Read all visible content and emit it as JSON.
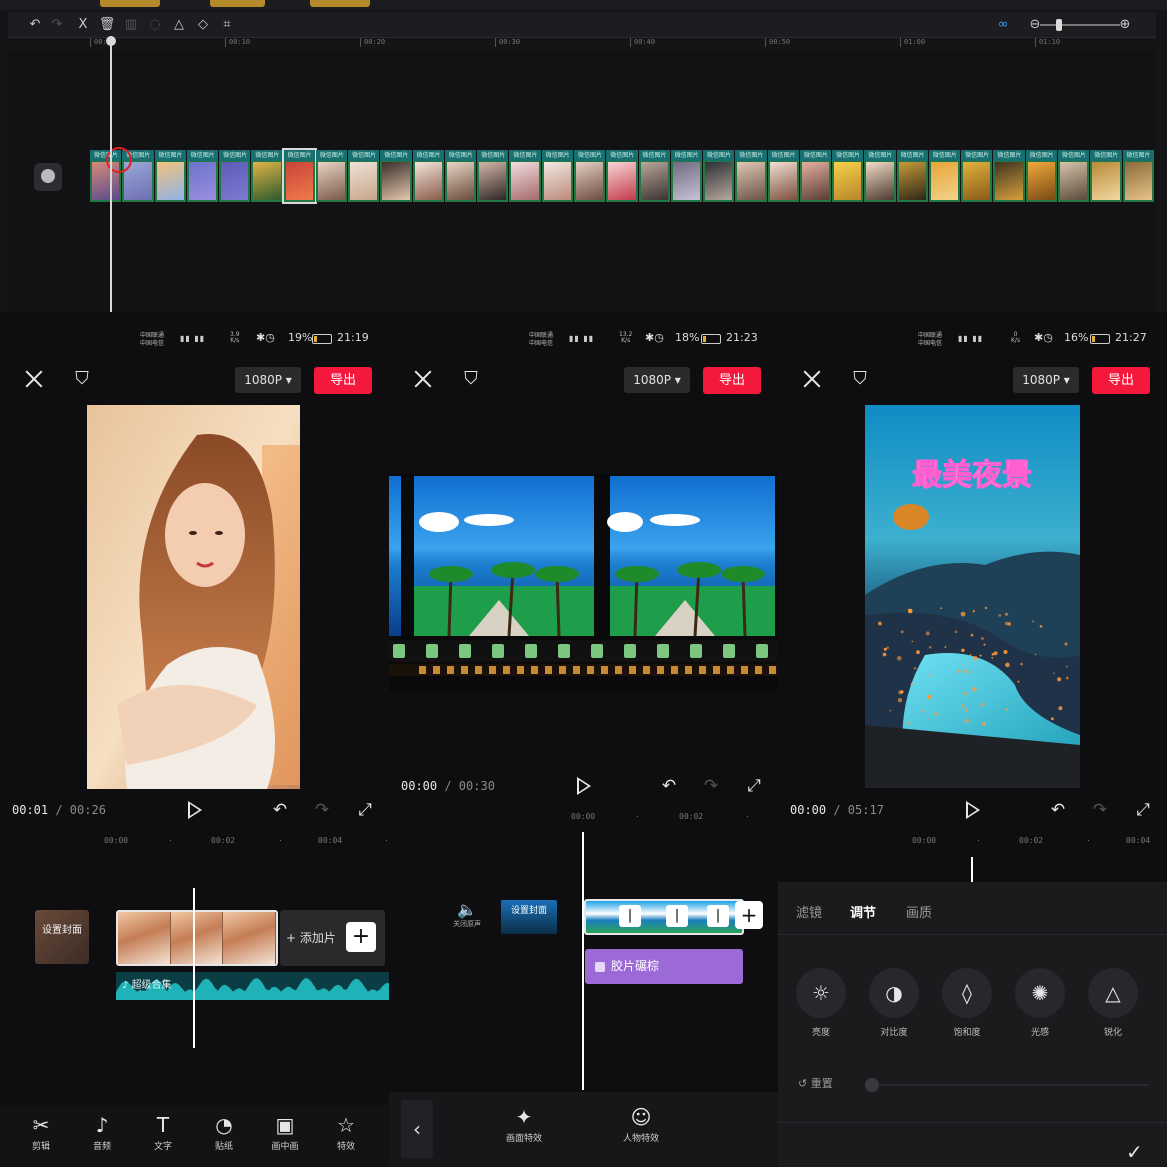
{
  "desktop": {
    "toolbar_icons": [
      "undo-icon",
      "redo-icon",
      "split-icon",
      "delete-icon",
      "freeze-icon",
      "reverse-icon",
      "mirror-icon",
      "rotate-icon",
      "crop-icon"
    ],
    "ruler": [
      "00:00",
      "00:10",
      "00:20",
      "00:30",
      "00:40",
      "00:50",
      "01:00",
      "01:10"
    ],
    "clip_label": "微信图片",
    "clip_count": 33
  },
  "panels": [
    {
      "status": {
        "carrier1": "中国联通",
        "carrier2": "中国电信",
        "speed_top": "3.9",
        "speed_bottom": "K/s",
        "battery": "19%",
        "battery_level": 0.19,
        "time": "21:19"
      },
      "resolution": "1080P ▾",
      "export": "导出",
      "timecode_current": "00:01",
      "timecode_total": " / 00:26",
      "ruler": [
        "00:00",
        "00:02",
        "00:04"
      ],
      "cover_label": "设置封面",
      "add_clip": "+ 添加片",
      "audio_label": "♪ 超级合集",
      "tools": [
        {
          "icon": "scissors-icon",
          "glyph": "✂",
          "label": "剪辑"
        },
        {
          "icon": "music-icon",
          "glyph": "♪",
          "label": "音频"
        },
        {
          "icon": "text-icon",
          "glyph": "T",
          "label": "文字"
        },
        {
          "icon": "sticker-icon",
          "glyph": "◔",
          "label": "贴纸"
        },
        {
          "icon": "pip-icon",
          "glyph": "▣",
          "label": "画中画"
        },
        {
          "icon": "effects-icon",
          "glyph": "☆",
          "label": "特效"
        }
      ]
    },
    {
      "status": {
        "carrier1": "中国联通",
        "carrier2": "中国电信",
        "speed_top": "13.2",
        "speed_bottom": "K/s",
        "battery": "18%",
        "battery_level": 0.18,
        "time": "21:23"
      },
      "resolution": "1080P ▾",
      "export": "导出",
      "timecode_current": "00:00",
      "timecode_total": " / 00:30",
      "ruler": [
        "00:00",
        "00:02"
      ],
      "mute_label": "关闭原声",
      "cover_label": "设置封面",
      "effect_label": "胶片碾棕",
      "tools": [
        {
          "icon": "scene-effect-icon",
          "glyph": "✦",
          "label": "画面特效"
        },
        {
          "icon": "face-effect-icon",
          "glyph": "☺",
          "label": "人物特效"
        }
      ]
    },
    {
      "status": {
        "carrier1": "中国联通",
        "carrier2": "中国电信",
        "speed_top": "0",
        "speed_bottom": "K/s",
        "battery": "16%",
        "battery_level": 0.16,
        "time": "21:27"
      },
      "resolution": "1080P ▾",
      "export": "导出",
      "video_title": "最美夜景",
      "timecode_current": "00:00",
      "timecode_total": " / 05:17",
      "ruler": [
        "00:00",
        "00:02",
        "00:04"
      ],
      "tabs": [
        "滤镜",
        "调节",
        "画质"
      ],
      "active_tab": "调节",
      "adjust": [
        {
          "icon": "brightness-icon",
          "glyph": "☼",
          "label": "亮度"
        },
        {
          "icon": "contrast-icon",
          "glyph": "◑",
          "label": "对比度"
        },
        {
          "icon": "saturation-icon",
          "glyph": "◊",
          "label": "饱和度"
        },
        {
          "icon": "highlight-icon",
          "glyph": "✺",
          "label": "光感"
        },
        {
          "icon": "sharpen-icon",
          "glyph": "△",
          "label": "锐化"
        }
      ],
      "reset_label": "重置"
    }
  ]
}
